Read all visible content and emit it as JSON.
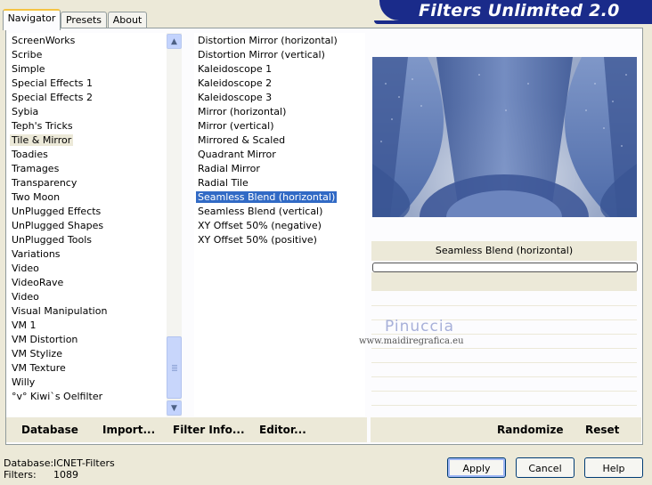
{
  "title": "Filters Unlimited 2.0",
  "tabs": [
    "Navigator",
    "Presets",
    "About"
  ],
  "categories": [
    "ScreenWorks",
    "Scribe",
    "Simple",
    "Special Effects 1",
    "Special Effects 2",
    "Sybia",
    "Teph's Tricks",
    "Tile & Mirror",
    "Toadies",
    "Tramages",
    "Transparency",
    "Two Moon",
    "UnPlugged Effects",
    "UnPlugged Shapes",
    "UnPlugged Tools",
    "Variations",
    "Video",
    "VideoRave",
    "Video",
    "Visual Manipulation",
    "VM 1",
    "VM Distortion",
    "VM Stylize",
    "VM Texture",
    "Willy",
    "°v° Kiwi`s Oelfilter"
  ],
  "selected_category": "Tile & Mirror",
  "filters": [
    "Distortion Mirror (horizontal)",
    "Distortion Mirror (vertical)",
    "Kaleidoscope 1",
    "Kaleidoscope 2",
    "Kaleidoscope 3",
    "Mirror (horizontal)",
    "Mirror (vertical)",
    "Mirrored & Scaled",
    "Quadrant Mirror",
    "Radial Mirror",
    "Radial Tile",
    "Seamless Blend (horizontal)",
    "Seamless Blend (vertical)",
    "XY Offset 50% (negative)",
    "XY Offset 50% (positive)"
  ],
  "selected_filter": "Seamless Blend (horizontal)",
  "param_label": "Seamless Blend (horizontal)",
  "commands": {
    "database": "Database",
    "import": "Import...",
    "filter_info": "Filter Info...",
    "editor": "Editor...",
    "randomize": "Randomize",
    "reset": "Reset"
  },
  "status": {
    "database_label": "Database:",
    "database_value": "ICNET-Filters",
    "filters_label": "Filters:",
    "filters_value": "1089"
  },
  "buttons": {
    "apply": "Apply",
    "cancel": "Cancel",
    "help": "Help"
  },
  "watermark": {
    "name": "Pinuccia",
    "url": "www.maidiregrafica.eu"
  },
  "colors": {
    "banner": "#1a2b8a",
    "selection": "#316ac5",
    "tab_accent": "#f5c443"
  },
  "icons": {
    "scroll_up": "chevron-up-icon",
    "scroll_down": "chevron-down-icon"
  }
}
